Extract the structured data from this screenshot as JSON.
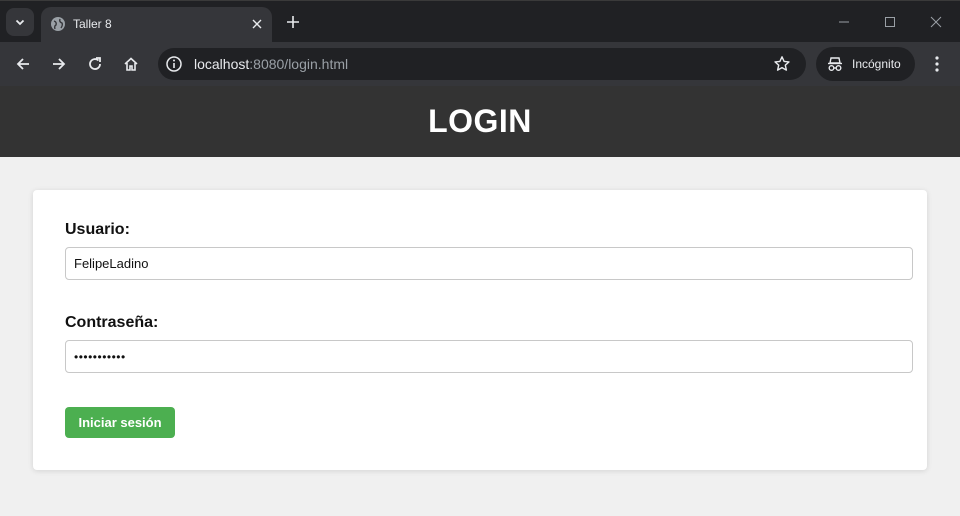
{
  "browser": {
    "tab_title": "Taller 8",
    "url_host": "localhost",
    "url_rest": ":8080/login.html",
    "incognito_label": "Incógnito"
  },
  "header": {
    "title": "LOGIN"
  },
  "form": {
    "username_label": "Usuario:",
    "username_value": "FelipeLadino",
    "password_label": "Contraseña:",
    "password_value": "•••••••••••",
    "submit_label": "Iniciar sesión"
  },
  "colors": {
    "header_bg": "#333333",
    "button_bg": "#4caf50",
    "page_bg": "#f0f0f0"
  }
}
